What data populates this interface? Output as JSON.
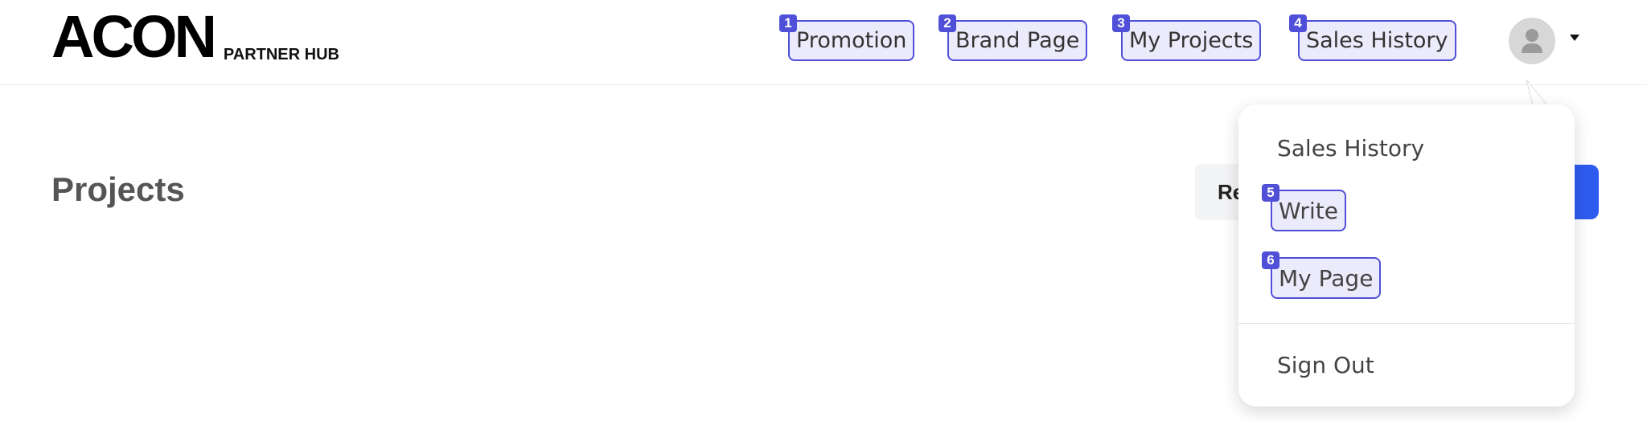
{
  "header": {
    "logo": "ACON",
    "logo_sub": "PARTNER HUB",
    "nav": [
      {
        "badge": "1",
        "label": "Promotion"
      },
      {
        "badge": "2",
        "label": "Brand Page"
      },
      {
        "badge": "3",
        "label": "My Projects"
      },
      {
        "badge": "4",
        "label": "Sales History"
      }
    ],
    "avatar_icon": "user-avatar-icon",
    "caret_icon": "caret-down-icon"
  },
  "main": {
    "title": "Projects",
    "secondary_button_label": "Re"
  },
  "dropdown": {
    "items": [
      {
        "label": "Sales History"
      },
      {
        "badge": "5",
        "label": "Write"
      },
      {
        "badge": "6",
        "label": "My Page"
      }
    ],
    "signout_label": "Sign Out"
  },
  "colors": {
    "accent": "#4f4fd8",
    "primary": "#2f5cf0",
    "highlight_bg": "#ecebfb"
  }
}
